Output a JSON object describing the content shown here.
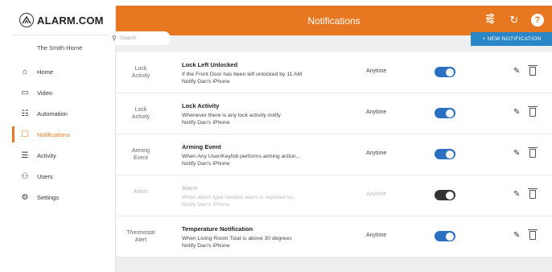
{
  "brand": {
    "name": "ALARM.COM"
  },
  "sidebar": {
    "home_name": "The Smith Home",
    "items": [
      {
        "label": "Home",
        "icon": "house-icon",
        "glyph": "⌂"
      },
      {
        "label": "Video",
        "icon": "video-camera-icon",
        "glyph": "▭"
      },
      {
        "label": "Automation",
        "icon": "sliders-icon",
        "glyph": "☷"
      },
      {
        "label": "Notifications",
        "icon": "notification-icon",
        "glyph": "☐",
        "active": true
      },
      {
        "label": "Activity",
        "icon": "activity-icon",
        "glyph": "☰"
      },
      {
        "label": "Users",
        "icon": "users-icon",
        "glyph": "⚇"
      },
      {
        "label": "Settings",
        "icon": "gear-icon",
        "glyph": "⚙"
      }
    ]
  },
  "header": {
    "title": "Notifications",
    "icons": [
      "filter-icon",
      "refresh-icon",
      "help-icon"
    ]
  },
  "toolbar": {
    "search_placeholder": "Search",
    "new_label": "+ NEW NOTIFICATION"
  },
  "colors": {
    "brand_orange": "#e87722",
    "toggle_on": "#2a6fc0",
    "toggle_off": "#333333",
    "button_blue": "#2a86c6"
  },
  "notifications": [
    {
      "category": "Lock\nActivity",
      "title": "Lock Left Unlocked",
      "line1": "If the Front Door has been left unlocked by 11 AM",
      "line2": "Notify Dan's iPhone",
      "time": "Anytime",
      "enabled": true
    },
    {
      "category": "Lock\nActivity",
      "title": "Lock Activity",
      "line1": "Whenever there is any lock activity notify",
      "line2": "Notify Dan's iPhone",
      "time": "Anytime",
      "enabled": true
    },
    {
      "category": "Arming\nEvent",
      "title": "Arming Event",
      "line1": "When Any User/Keyfob performs arming action...",
      "line2": "Notify Dan's iPhone",
      "time": "Anytime",
      "enabled": true
    },
    {
      "category": "Alarm",
      "title": "Alarm",
      "line1": "When alarm type needed alarm is reported by...",
      "line2": "Notify Dan's iPhone",
      "time": "Anytime",
      "enabled": false
    },
    {
      "category": "Thermostat\nAlert",
      "title": "Temperature Notification",
      "line1": "When Living Room Tstat is above 30 degrees",
      "line2": "Notify Dan's iPhone",
      "time": "Anytime",
      "enabled": true
    }
  ]
}
